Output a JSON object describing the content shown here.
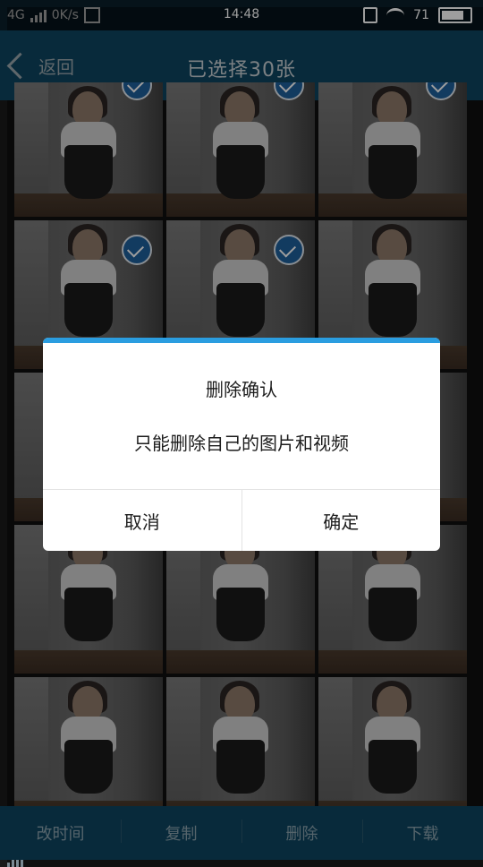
{
  "status": {
    "network": "4G",
    "speed": "0K/s",
    "time": "14:48",
    "battery": "71",
    "colors": {
      "bar": "#0a1f2a"
    }
  },
  "header": {
    "back_label": "返回",
    "title": "已选择30张",
    "icons": {
      "back": "chevron-left-icon"
    }
  },
  "grid": {
    "selected_indicator_icon": "checkmark-circle-icon"
  },
  "dialog": {
    "title": "删除确认",
    "message": "只能删除自己的图片和视频",
    "cancel_label": "取消",
    "confirm_label": "确定",
    "accent": "#2a9de0"
  },
  "toolbar": {
    "items": [
      {
        "label": "改时间"
      },
      {
        "label": "复制"
      },
      {
        "label": "删除"
      },
      {
        "label": "下载"
      }
    ],
    "background": "#0e4560"
  }
}
